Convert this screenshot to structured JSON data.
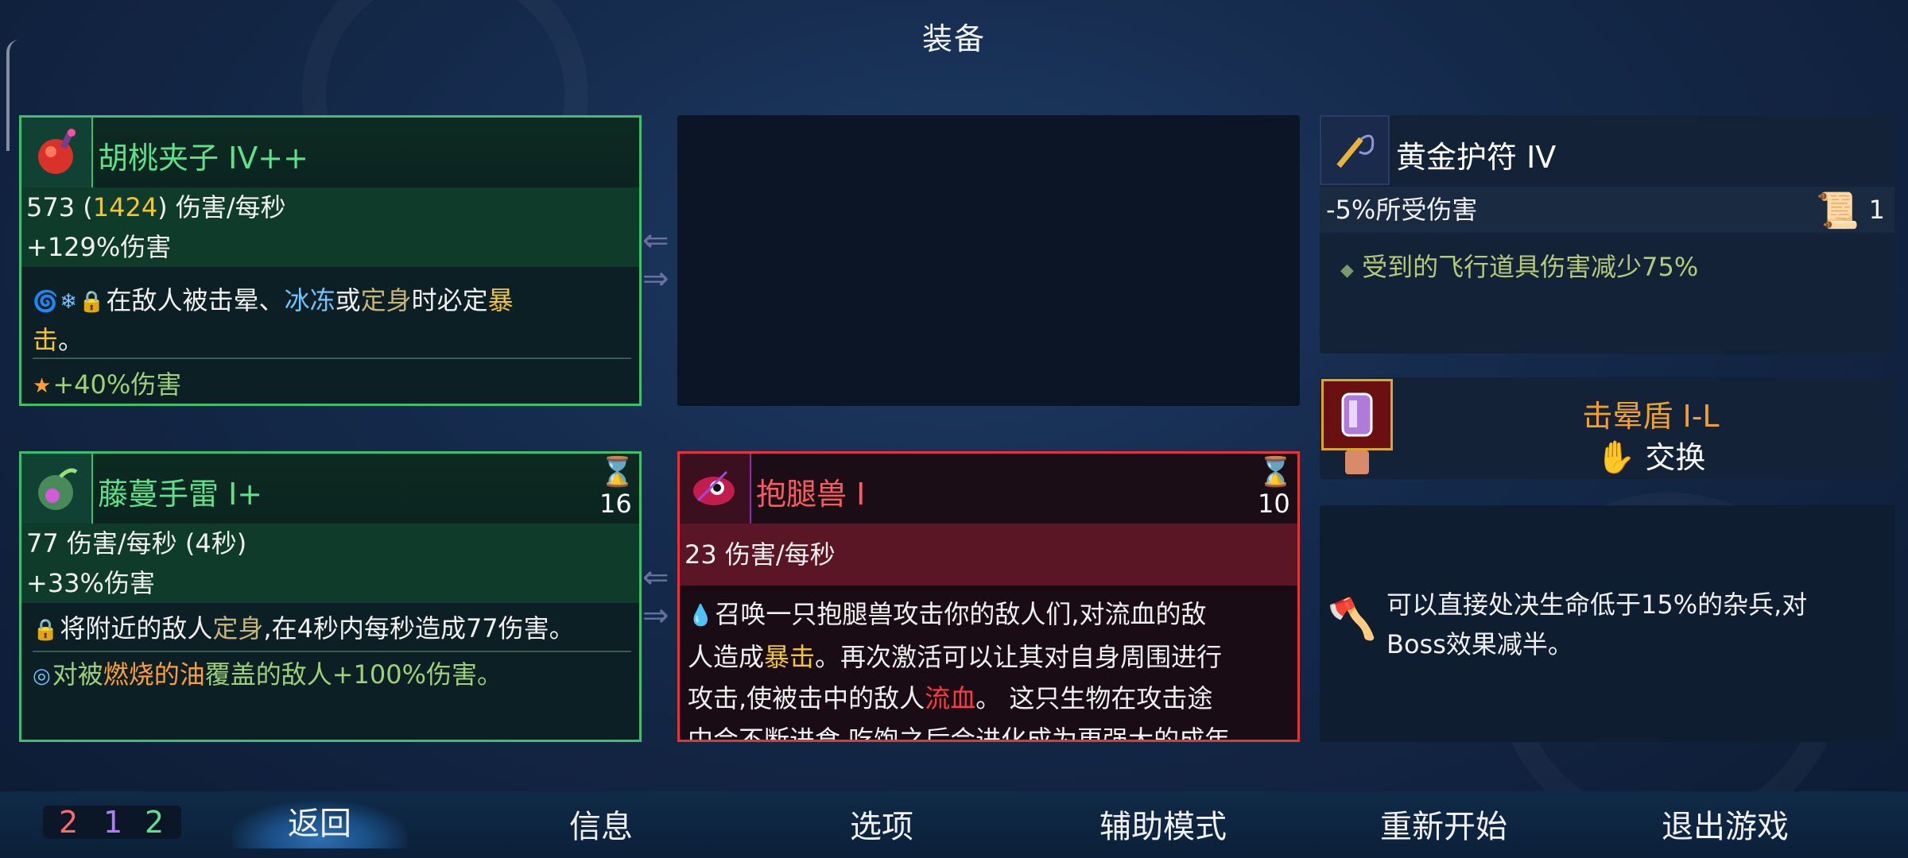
{
  "title": "装备",
  "weapons": [
    {
      "name": "胡桃夹子 IV++",
      "dps_base": "573",
      "dps_crit": "1424",
      "dps_unit": "伤害/每秒",
      "bonus": "+129%伤害",
      "desc": {
        "pre": "在敌人被击晕、",
        "freeze": "冰冻",
        "or": "或",
        "root": "定身",
        "mid": "时必定",
        "crit1": "暴",
        "crit2": "击",
        "end": "。"
      },
      "extra": "+40%伤害",
      "icon": "nutcracker-bomb-icon"
    },
    {
      "name": "藤蔓手雷 I+",
      "timer": "16",
      "dps": "77 伤害/每秒 (4秒)",
      "bonus": "+33%伤害",
      "desc": {
        "pre": "将附近的敌人",
        "root": "定身",
        "post": ",在4秒内每秒造成77伤害。"
      },
      "extra": {
        "pre": "对被",
        "burn": "燃烧的油",
        "post": "覆盖的敌人+100%伤害。"
      },
      "icon": "vine-grenade-icon"
    }
  ],
  "skill": {
    "name": "抱腿兽 I",
    "timer": "10",
    "dps": "23 伤害/每秒",
    "desc": {
      "l1": "召唤一只抱腿兽攻击你的敌人们,对流血的敌",
      "l2pre": "人造成",
      "crit": "暴击",
      "l2post": "。再次激活可以让其对自身周围进行",
      "l3pre": "攻击,使被击中的敌人",
      "bleed": "流血",
      "l3post": "。 这只生物在攻击途",
      "l4": "中会不断进食,吃饱之后会进化成为更强大的成年"
    },
    "icon": "leghugger-icon"
  },
  "amulet": {
    "name": "黄金护符 IV",
    "stat": "-5%所受伤害",
    "scroll_count": "1",
    "effect": "受到的飞行道具伤害减少75%",
    "icon": "golden-amulet-icon"
  },
  "shield": {
    "name": "击晕盾 I-L",
    "swap": "交换",
    "icon": "stun-shield-icon"
  },
  "mutation": {
    "text_l1": "可以直接处决生命低于15%的杂兵,对",
    "text_l2": "Boss效果减半。",
    "icon": "executioner-icon"
  },
  "bottom": {
    "scrolls": [
      "2",
      "1",
      "2"
    ],
    "menu": [
      "返回",
      "信息",
      "选项",
      "辅助模式",
      "重新开始",
      "退出游戏"
    ]
  },
  "colors": {
    "brutality": "#ff5a5a",
    "tactics": "#b07cff",
    "survival": "#5fe08a"
  }
}
